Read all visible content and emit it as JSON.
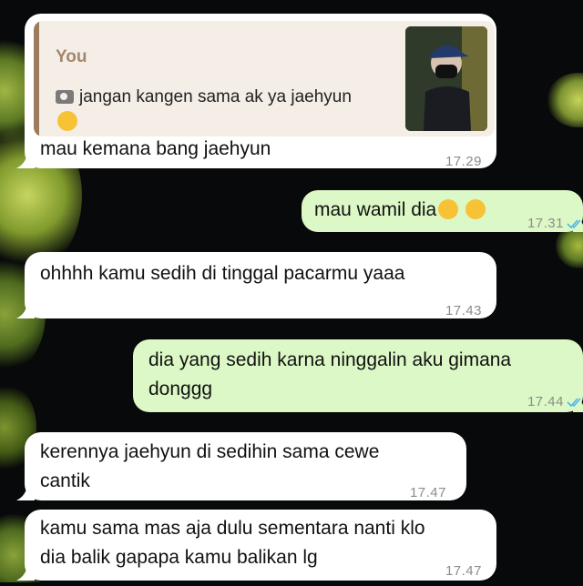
{
  "reply": {
    "quoted_sender": "You",
    "quoted_text": "jangan kangen sama ak ya jaehyun",
    "quoted_icon": "camera-icon",
    "text": "mau kemana bang jaehyun",
    "time": "17.29"
  },
  "messages": [
    {
      "direction": "out",
      "text": "mau wamil dia",
      "time": "17.31",
      "status": "read"
    },
    {
      "direction": "in",
      "lines": [
        "ohhhh kamu sedih di tinggal pacarmu yaaa"
      ],
      "time": "17.43"
    },
    {
      "direction": "out",
      "lines": [
        "dia yang sedih karna ninggalin aku gimana",
        "donggg"
      ],
      "time": "17.44",
      "status": "read"
    },
    {
      "direction": "in",
      "lines": [
        "kerennya jaehyun di sedihin sama cewe",
        "cantik"
      ],
      "time": "17.47"
    },
    {
      "direction": "in",
      "lines": [
        "kamu sama mas aja dulu sementara nanti klo",
        "dia balik gapapa kamu balikan lg"
      ],
      "time": "17.47"
    }
  ],
  "colors": {
    "incoming_bubble": "#ffffff",
    "outgoing_bubble": "#dcf8c6",
    "read_ticks": "#4fb6ec",
    "quote_accent": "#9e7b5d"
  }
}
